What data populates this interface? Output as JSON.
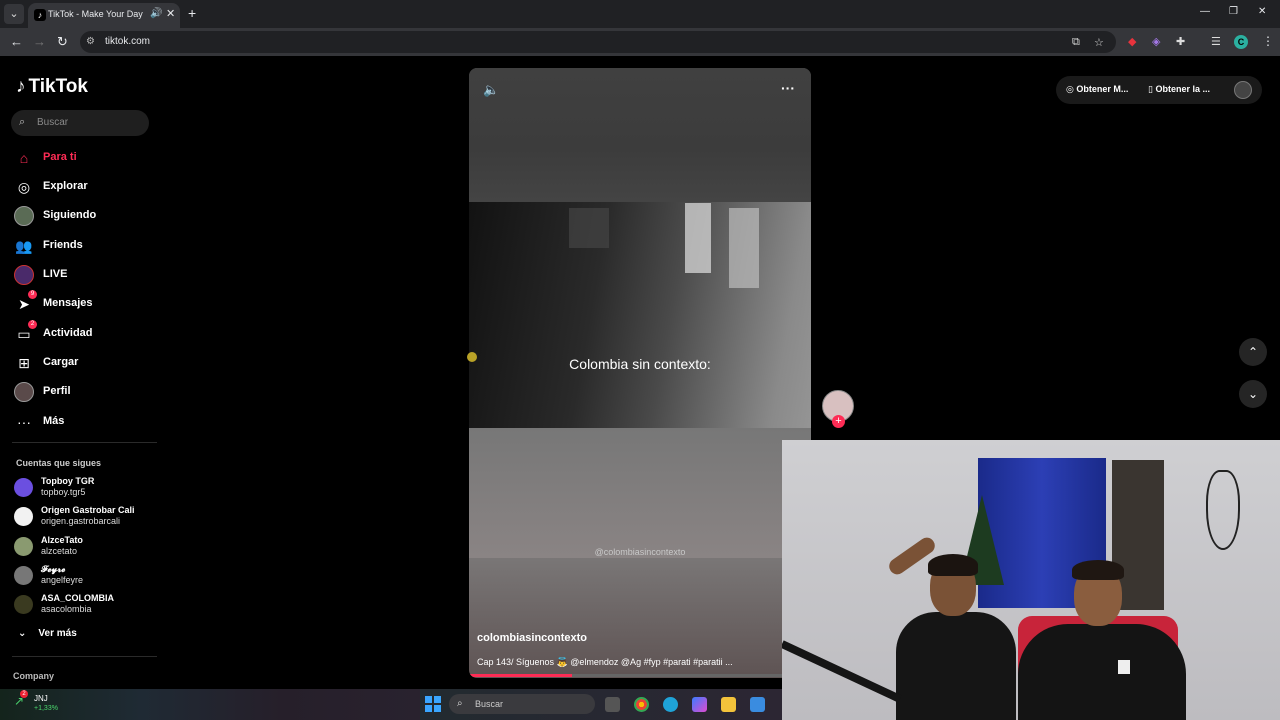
{
  "browser": {
    "tab_title": "TikTok - Make Your Day",
    "url": "tiktok.com",
    "profile_initial": "C"
  },
  "sidebar": {
    "logo": "TikTok",
    "search_placeholder": "Buscar",
    "items": [
      {
        "label": "Para ti",
        "icon": "home-icon",
        "active": true
      },
      {
        "label": "Explorar",
        "icon": "compass-icon"
      },
      {
        "label": "Siguiendo",
        "icon": "avatar"
      },
      {
        "label": "Friends",
        "icon": "friends-icon"
      },
      {
        "label": "LIVE",
        "icon": "live-icon"
      },
      {
        "label": "Mensajes",
        "icon": "send-icon",
        "badge": "9"
      },
      {
        "label": "Actividad",
        "icon": "inbox-icon",
        "badge": "2"
      },
      {
        "label": "Cargar",
        "icon": "upload-icon"
      },
      {
        "label": "Perfil",
        "icon": "avatar"
      },
      {
        "label": "Más",
        "icon": "more-icon"
      }
    ],
    "following_title": "Cuentas que sigues",
    "following": [
      {
        "name": "Topboy TGR",
        "handle": "topboy.tgr5",
        "color": "#6b4fe0"
      },
      {
        "name": "Origen Gastrobar Cali",
        "handle": "origen.gastrobarcali",
        "color": "#f2f2f2"
      },
      {
        "name": "AlzceTato",
        "handle": "alzcetato",
        "color": "#8a9a70"
      },
      {
        "name": "𝓕𝓮𝔂𝓻𝓮",
        "handle": "angelfeyre",
        "color": "#777777"
      },
      {
        "name": "ASA_COLOMBIA",
        "handle": "asacolombia",
        "color": "#3a3a20"
      }
    ],
    "see_more": "Ver más",
    "company": "Company"
  },
  "video": {
    "caption": "Colombia sin contexto:",
    "watermark": "@colombiasincontexto",
    "author": "colombiasincontexto",
    "description": "Cap 143/ Síguenos 👼 @elmendoz @Ag #fyp #parati #paratii ...",
    "progress": 0.3
  },
  "top_actions": {
    "get_coins": "Obtener M...",
    "get_app": "Obtener la ..."
  },
  "taskbar": {
    "stock_name": "JNJ",
    "stock_change": "+1,33%",
    "stock_badge": "2",
    "search_placeholder": "Buscar"
  },
  "colors": {
    "accent": "#fe2c55",
    "background": "#000000"
  }
}
